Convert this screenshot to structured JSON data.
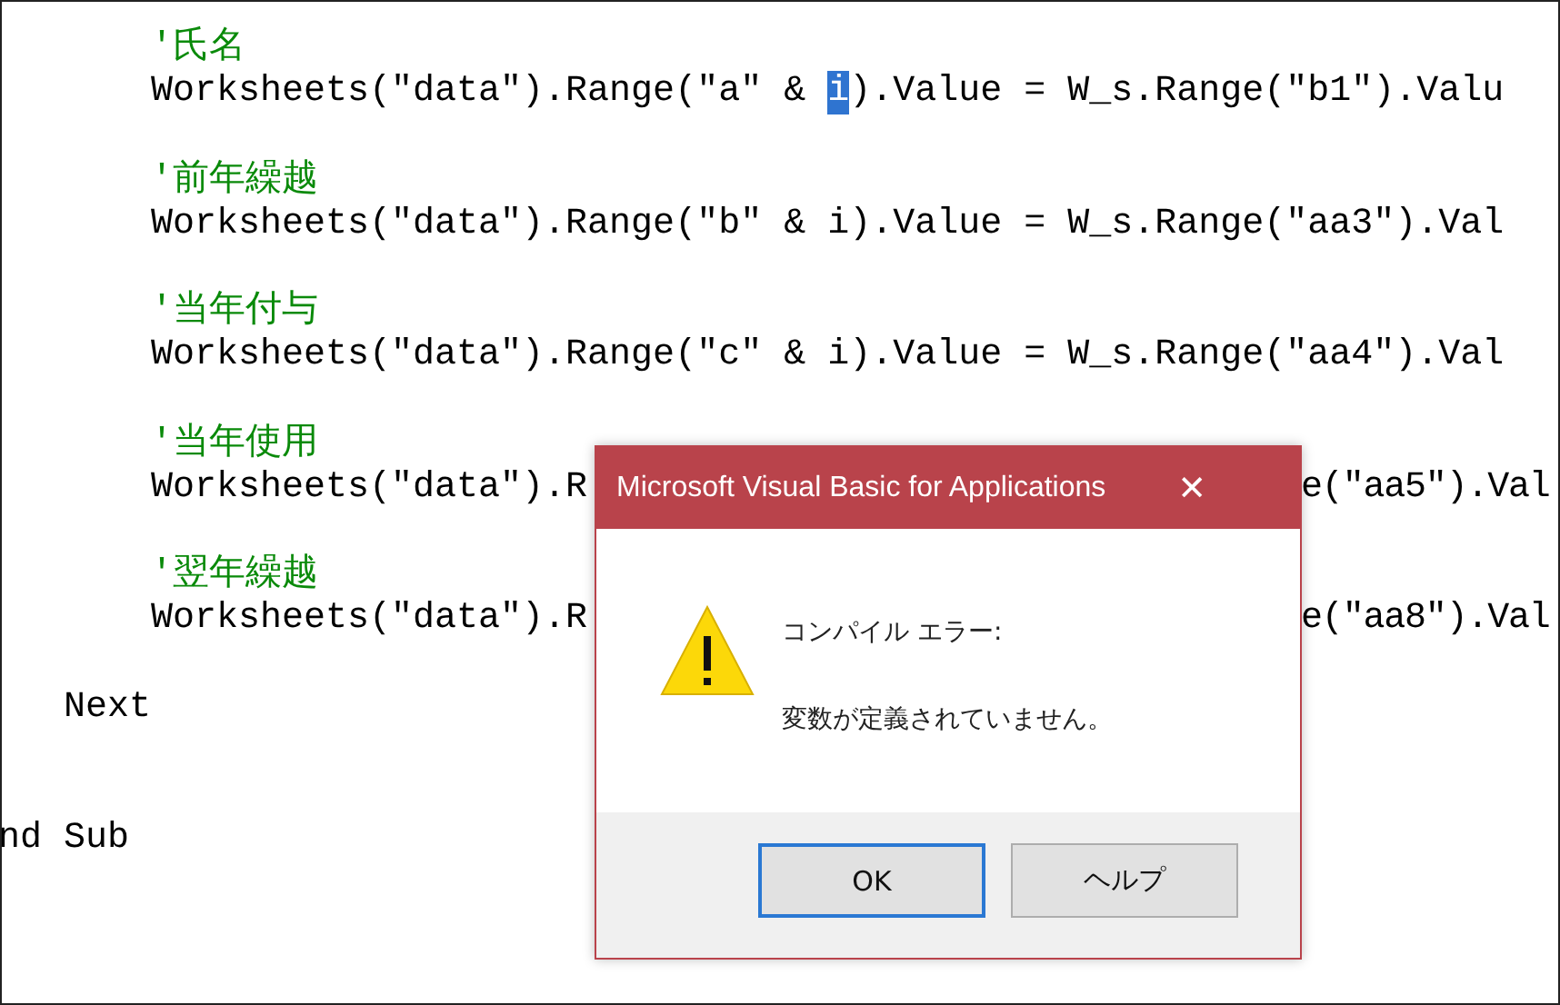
{
  "editor": {
    "lines": [
      {
        "kind": "comment",
        "parts": [
          {
            "text": "'氏名",
            "selected": false
          }
        ]
      },
      {
        "kind": "code",
        "parts": [
          {
            "text": "Worksheets(\"data\").Range(\"a\" & ",
            "selected": false
          },
          {
            "text": "i",
            "selected": true
          },
          {
            "text": ").Value = W_s.Range(\"b1\").Valu",
            "selected": false
          }
        ]
      },
      {
        "kind": "blank"
      },
      {
        "kind": "comment",
        "parts": [
          {
            "text": "'前年繰越",
            "selected": false
          }
        ]
      },
      {
        "kind": "code",
        "parts": [
          {
            "text": "Worksheets(\"data\").Range(\"b\" & i).Value = W_s.Range(\"aa3\").Val",
            "selected": false
          }
        ]
      },
      {
        "kind": "blank"
      },
      {
        "kind": "comment",
        "parts": [
          {
            "text": "'当年付与",
            "selected": false
          }
        ]
      },
      {
        "kind": "code",
        "parts": [
          {
            "text": "Worksheets(\"data\").Range(\"c\" & i).Value = W_s.Range(\"aa4\").Val",
            "selected": false
          }
        ]
      },
      {
        "kind": "blank"
      },
      {
        "kind": "comment",
        "parts": [
          {
            "text": "'当年使用",
            "selected": false
          }
        ]
      },
      {
        "kind": "code",
        "parts": [
          {
            "text": "Worksheets(\"data\").R",
            "selected": false
          },
          {
            "text": "e(\"aa5\").Val",
            "selected": false,
            "kind": "resume"
          }
        ]
      },
      {
        "kind": "blank"
      },
      {
        "kind": "comment",
        "parts": [
          {
            "text": "'翌年繰越",
            "selected": false
          }
        ]
      },
      {
        "kind": "code",
        "parts": [
          {
            "text": "Worksheets(\"data\").R",
            "selected": false
          },
          {
            "text": "e(\"aa8\").Val",
            "selected": false,
            "kind": "resume"
          }
        ]
      },
      {
        "kind": "blank"
      },
      {
        "kind": "loop-end",
        "parts": [
          {
            "text": "Next",
            "selected": false
          }
        ]
      },
      {
        "kind": "blank"
      },
      {
        "kind": "blank"
      },
      {
        "kind": "sub-end",
        "parts": [
          {
            "text": "nd Sub",
            "selected": false
          }
        ]
      }
    ]
  },
  "dialog": {
    "title": "Microsoft Visual Basic for Applications",
    "close": "✕",
    "heading": "コンパイル エラー:",
    "message": "変数が定義されていません。",
    "buttons": [
      {
        "label": "OK",
        "selected": true
      },
      {
        "label": "ヘルプ",
        "selected": false
      }
    ]
  }
}
